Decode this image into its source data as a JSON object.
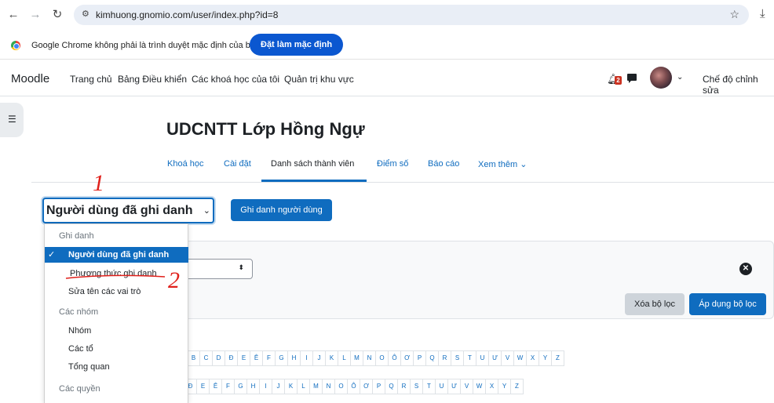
{
  "browser": {
    "url": "kimhuong.gnomio.com/user/index.php?id=8",
    "default_message": "Google Chrome không phải là trình duyệt mặc định của bạn",
    "set_default_label": "Đặt làm mặc định"
  },
  "navbar": {
    "brand": "Moodle",
    "items": [
      "Trang chủ",
      "Bảng Điều khiển",
      "Các khoá học của tôi",
      "Quản trị khu vực"
    ],
    "notification_count": "2",
    "edit_mode_label": "Chế độ chỉnh sửa"
  },
  "course": {
    "title": "UDCNTT Lớp Hồng Ngự"
  },
  "tabs": [
    "Khoá học",
    "Cài đặt",
    "Danh sách thành viên",
    "Điểm số",
    "Báo cáo",
    "Xem thêm"
  ],
  "participants": {
    "select_value": "Người dùng đã ghi danh",
    "enrol_button": "Ghi danh người dùng"
  },
  "filters": {
    "clear_label": "Xóa bộ lọc",
    "apply_label": "Áp dụng bộ lọc"
  },
  "initials": {
    "first_name": [
      "B",
      "C",
      "D",
      "Đ",
      "E",
      "Ê",
      "F",
      "G",
      "H",
      "I",
      "J",
      "K",
      "L",
      "M",
      "N",
      "O",
      "Ô",
      "Ơ",
      "P",
      "Q",
      "R",
      "S",
      "T",
      "U",
      "Ư",
      "V",
      "W",
      "X",
      "Y",
      "Z"
    ],
    "last_name": [
      "Đ",
      "E",
      "Ê",
      "F",
      "G",
      "H",
      "I",
      "J",
      "K",
      "L",
      "M",
      "N",
      "O",
      "Ô",
      "Ơ",
      "P",
      "Q",
      "R",
      "S",
      "T",
      "U",
      "Ư",
      "V",
      "W",
      "X",
      "Y",
      "Z"
    ]
  },
  "dropdown": {
    "group1_header": "Ghi danh",
    "selected": "Người dùng đã ghi danh",
    "item_methods": "Phương thức ghi danh",
    "item_rename_roles": "Sửa tên các vai trò",
    "group2_header": "Các nhóm",
    "item_groups": "Nhóm",
    "item_groupings": "Các tổ",
    "item_overview": "Tổng quan",
    "group3_header": "Các quyền"
  },
  "annotations": {
    "mark1": "1",
    "mark2": "2",
    "color": "#e0201b"
  },
  "colors": {
    "primary": "#0f6cbf",
    "chrome_blue": "#0b57d0"
  }
}
